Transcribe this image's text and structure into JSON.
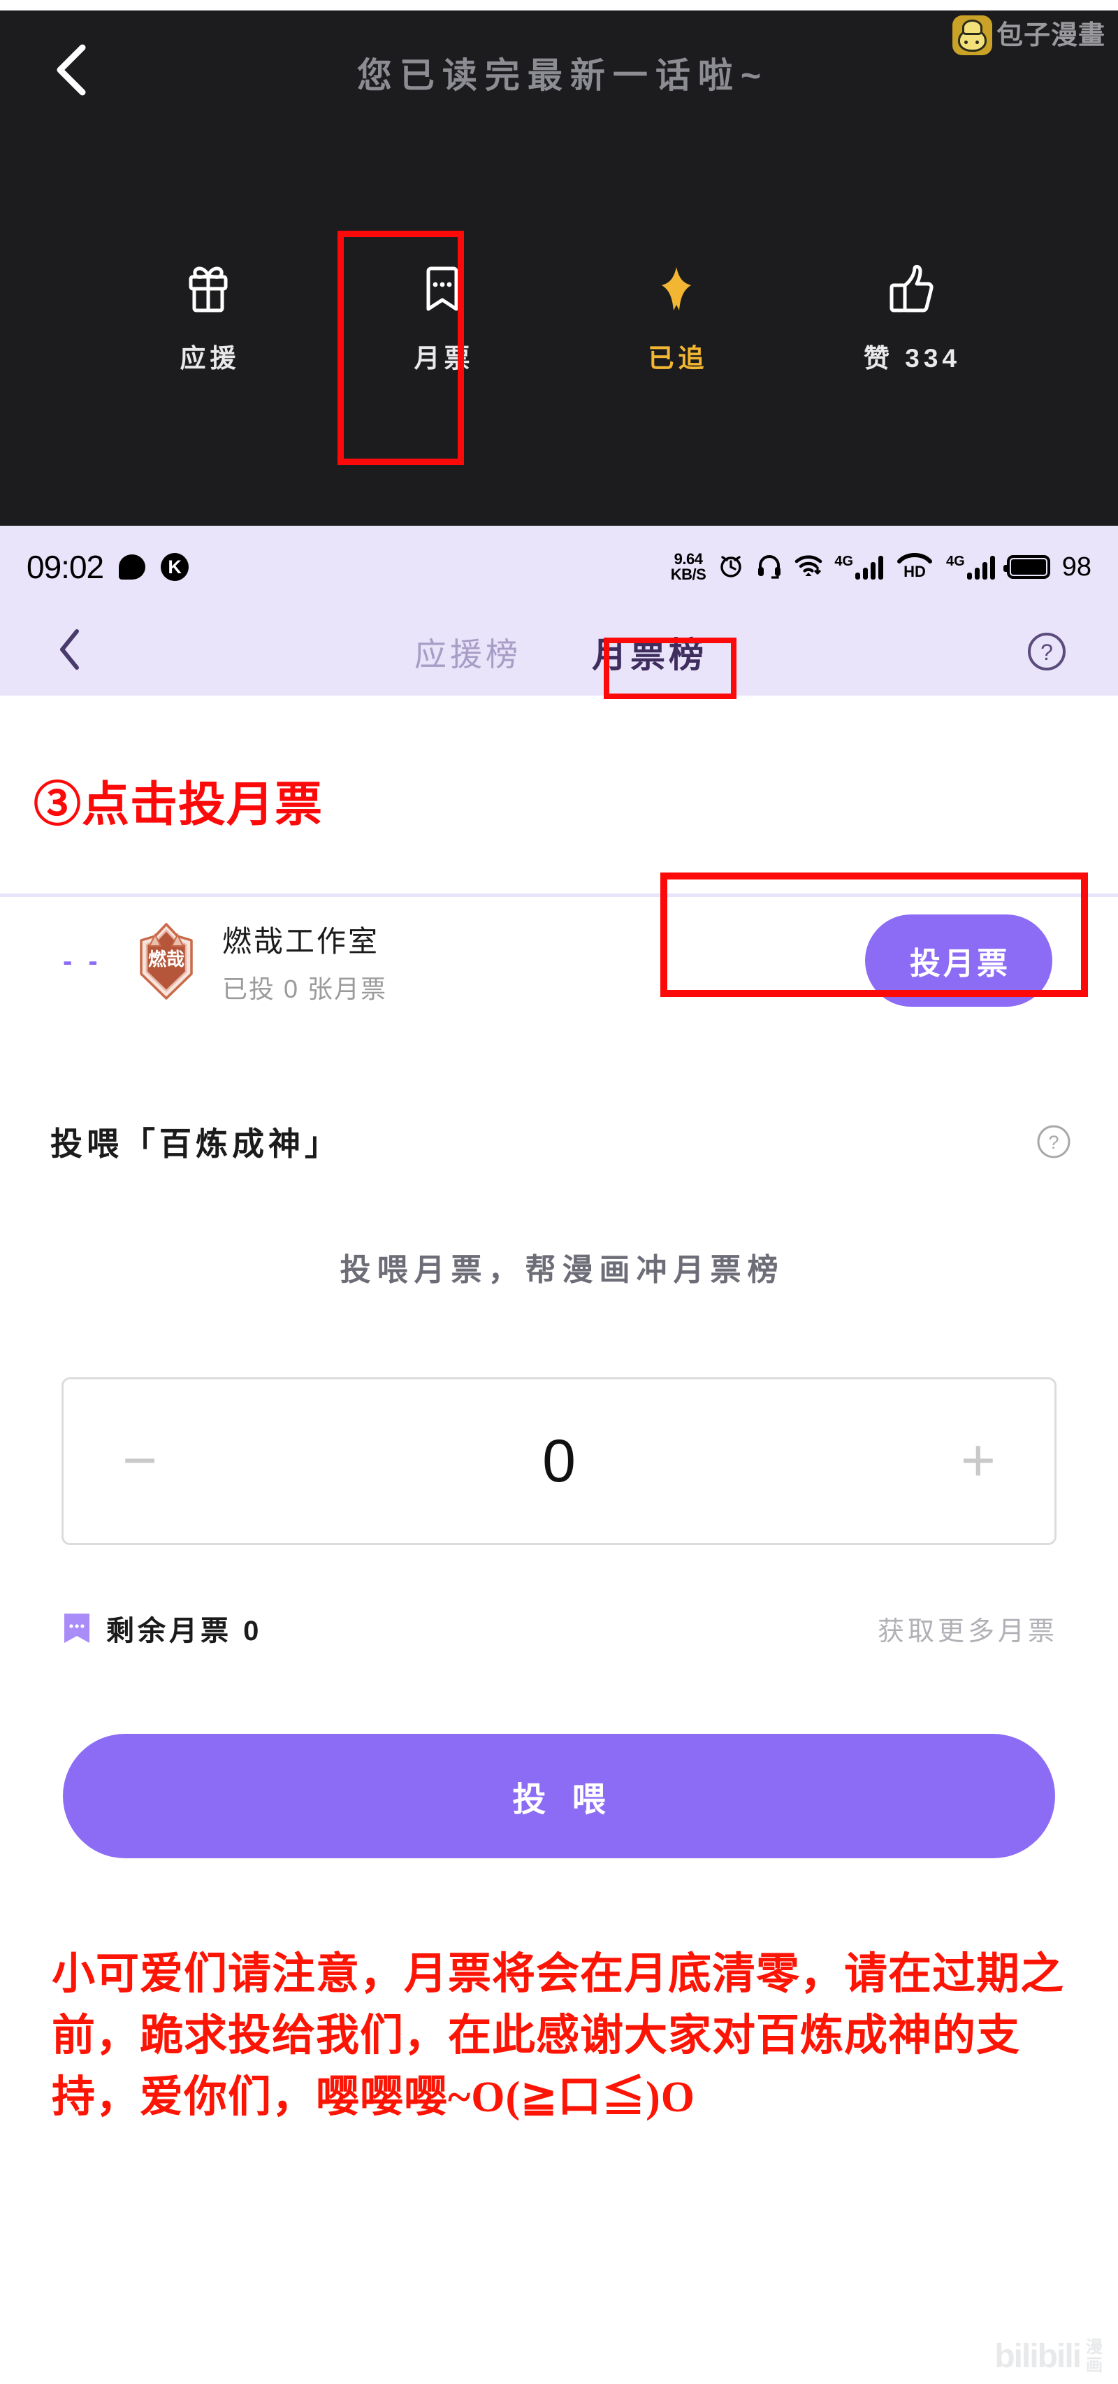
{
  "reader": {
    "finished_text": "您已读完最新一话啦~",
    "back_icon": "back-chevron-icon",
    "brand_name": "包子漫畫",
    "brand_icon": "baozi-bun-icon",
    "actions": [
      {
        "icon": "gift-icon",
        "label": "应援",
        "gold": false
      },
      {
        "icon": "ticket-icon",
        "label": "月票",
        "gold": false
      },
      {
        "icon": "star-icon",
        "label": "已追",
        "gold": true
      },
      {
        "icon": "thumbsup-icon",
        "label": "赞 334",
        "gold": false
      }
    ]
  },
  "status_bar": {
    "time": "09:02",
    "bubble_icon": "speech-bubble-icon",
    "k_badge": "K",
    "net_speed_value": "9.64",
    "net_speed_unit": "KB/S",
    "alarm_icon": "alarm-clock-icon",
    "headset_icon": "headset-icon",
    "wifi_icon": "wifi-download-icon",
    "sim1_label": "4G",
    "hd_label": "HD",
    "sim2_label": "4G",
    "battery_icon": "battery-icon",
    "battery_level": "98"
  },
  "nav": {
    "back_icon": "back-chevron-icon",
    "help_icon": "help-circle-icon",
    "tabs": [
      {
        "label": "应援榜",
        "active": false
      },
      {
        "label": "月票榜",
        "active": true
      }
    ]
  },
  "annotations": {
    "step3": "③点击投月票",
    "highlight_color": "#fc0a0a"
  },
  "studio_row": {
    "rank": "- -",
    "avatar_icon": "studio-shield-badge-icon",
    "avatar_text": "燃哉",
    "name": "燃哉工作室",
    "voted_text": "已投 0 张月票",
    "vote_button": "投月票"
  },
  "feed": {
    "title": "投喂「百炼成神」",
    "help_icon": "help-circle-icon",
    "subtitle": "投喂月票，帮漫画冲月票榜",
    "stepper": {
      "minus": "−",
      "plus": "+",
      "value": "0"
    },
    "remaining_icon": "ticket-icon",
    "remaining_label": "剩余月票 0",
    "get_more_label": "获取更多月票",
    "submit_label": "投 喂"
  },
  "notice": {
    "text": "小可爱们请注意，月票将会在月底清零，请在过期之前，跪求投给我们，在此感谢大家对百炼成神的支持，爱你们，嘤嘤嘤~O(≧口≦)O"
  },
  "watermark": {
    "bili": "bilibili",
    "cn_line1": "漫",
    "cn_line2": "画"
  },
  "colors": {
    "dark_bg": "#1c1c1e",
    "lavender_bg": "#e9e4fa",
    "accent_purple": "#8c6cf5",
    "gold": "#f2b632",
    "alert_red": "#fc0a0a"
  }
}
